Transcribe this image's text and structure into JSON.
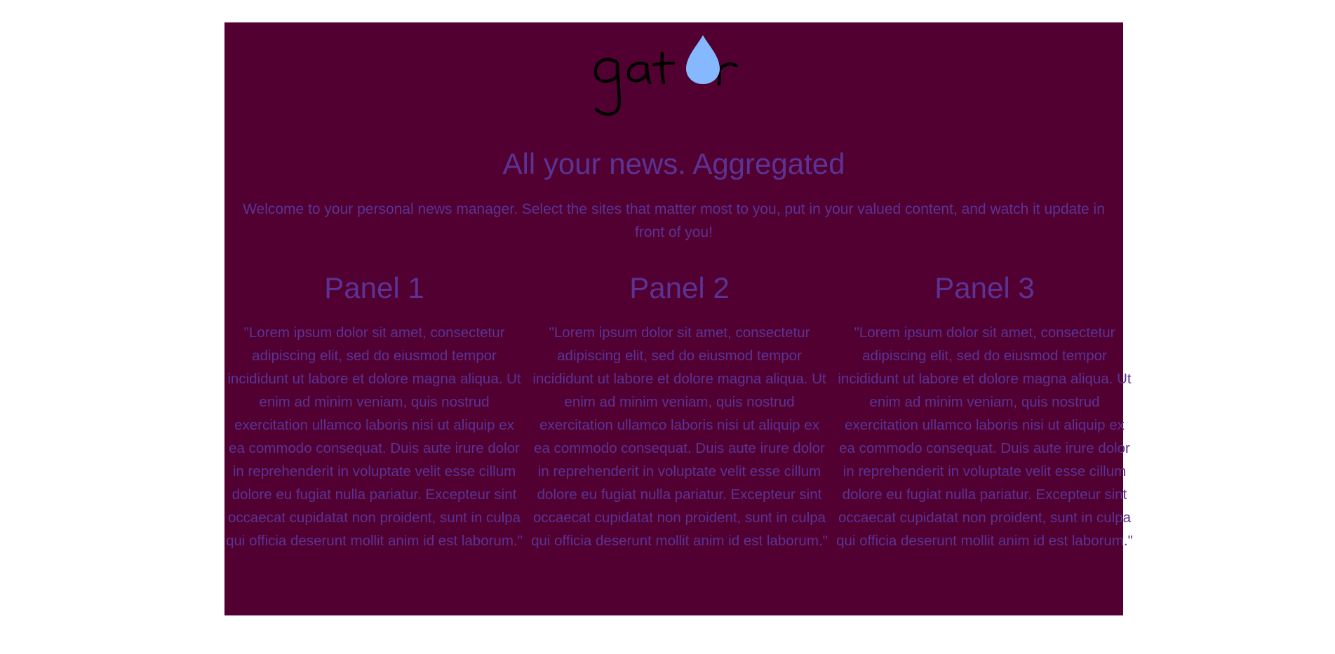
{
  "brand": {
    "name": "gator",
    "logo_ink_color": "#000000",
    "drop_color": "#86b8ff"
  },
  "hero": {
    "headline": "All your news. Aggregated",
    "intro": "Welcome to your personal news manager. Select the sites that matter most to you, put in your valued content, and watch it update in front of you!"
  },
  "panels": [
    {
      "title": "Panel 1",
      "body": "\"Lorem ipsum dolor sit amet, consectetur adipiscing elit, sed do eiusmod tempor incididunt ut labore et dolore magna aliqua. Ut enim ad minim veniam, quis nostrud exercitation ullamco laboris nisi ut aliquip ex ea commodo consequat. Duis aute irure dolor in reprehenderit in voluptate velit esse cillum dolore eu fugiat nulla pariatur. Excepteur sint occaecat cupidatat non proident, sunt in culpa qui officia deserunt mollit anim id est laborum.\""
    },
    {
      "title": "Panel 2",
      "body": "\"Lorem ipsum dolor sit amet, consectetur adipiscing elit, sed do eiusmod tempor incididunt ut labore et dolore magna aliqua. Ut enim ad minim veniam, quis nostrud exercitation ullamco laboris nisi ut aliquip ex ea commodo consequat. Duis aute irure dolor in reprehenderit in voluptate velit esse cillum dolore eu fugiat nulla pariatur. Excepteur sint occaecat cupidatat non proident, sunt in culpa qui officia deserunt mollit anim id est laborum.\""
    },
    {
      "title": "Panel 3",
      "body": "\"Lorem ipsum dolor sit amet, consectetur adipiscing elit, sed do eiusmod tempor incididunt ut labore et dolore magna aliqua. Ut enim ad minim veniam, quis nostrud exercitation ullamco laboris nisi ut aliquip ex ea commodo consequat. Duis aute irure dolor in reprehenderit in voluptate velit esse cillum dolore eu fugiat nulla pariatur. Excepteur sint occaecat cupidatat non proident, sunt in culpa qui officia deserunt mollit anim id est laborum.\""
    }
  ],
  "colors": {
    "page_background": "#ffffff",
    "container_background": "#520032",
    "text": "#5b3393"
  }
}
